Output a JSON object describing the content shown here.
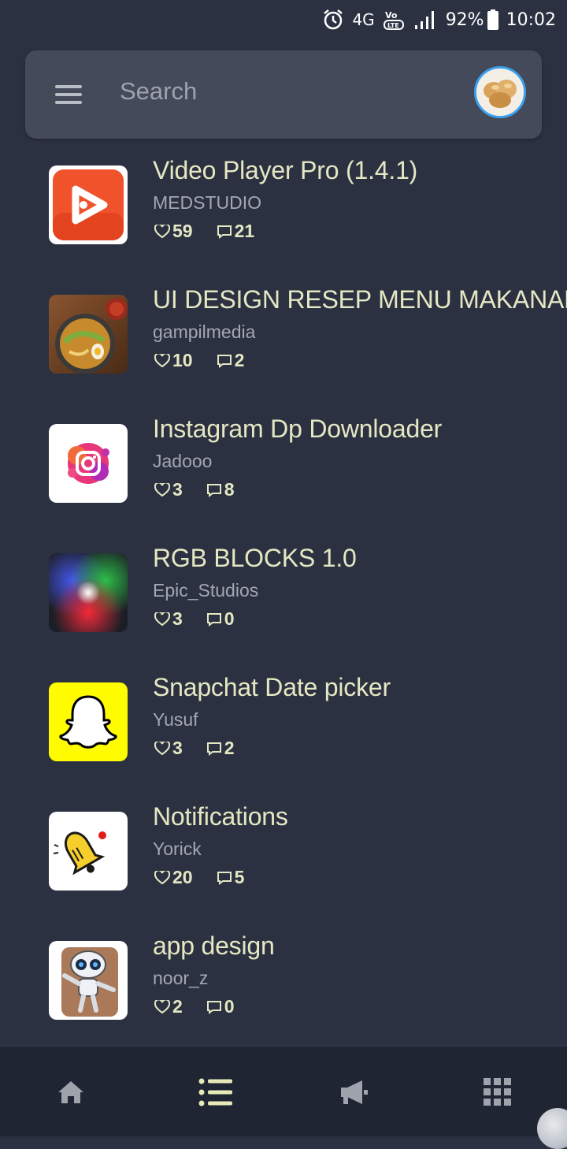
{
  "status_bar": {
    "network": "4G",
    "volte": "VoLTE",
    "battery": "92%",
    "time": "10:02",
    "icons": [
      "alarm-icon",
      "network-4g-icon",
      "volte-icon",
      "signal-icon",
      "battery-icon"
    ]
  },
  "search": {
    "placeholder": "Search",
    "menu_icon": "menu-icon",
    "avatar_icon": "avatar-image"
  },
  "items": [
    {
      "title": "Video Player Pro (1.4.1)",
      "author": "MEDSTUDIO",
      "likes": "59",
      "comments": "21",
      "icon": "video-player-app-icon"
    },
    {
      "title": "UI DESIGN RESEP MENU MAKANAN",
      "author": "gampilmedia",
      "likes": "10",
      "comments": "2",
      "icon": "food-bowl-image"
    },
    {
      "title": "Instagram Dp Downloader",
      "author": "Jadooo",
      "likes": "3",
      "comments": "8",
      "icon": "instagram-app-icon"
    },
    {
      "title": "RGB BLOCKS 1.0",
      "author": "Epic_Studios",
      "likes": "3",
      "comments": "0",
      "icon": "rgb-lights-image"
    },
    {
      "title": "Snapchat Date picker",
      "author": "Yusuf",
      "likes": "3",
      "comments": "2",
      "icon": "snapchat-app-icon"
    },
    {
      "title": "Notifications",
      "author": "Yorick",
      "likes": "20",
      "comments": "5",
      "icon": "bell-notification-icon"
    },
    {
      "title": "app design",
      "author": "noor_z",
      "likes": "2",
      "comments": "0",
      "icon": "robot-image"
    }
  ],
  "bottom_nav": {
    "items": [
      "home-icon",
      "list-icon",
      "megaphone-icon",
      "grid-apps-icon"
    ],
    "active": "list-icon"
  },
  "colors": {
    "background": "#2c3142",
    "search_bar": "#444a5a",
    "title_text": "#e4e8c2",
    "author_text": "#a3a7b1",
    "bottom_nav": "#1f2533"
  }
}
